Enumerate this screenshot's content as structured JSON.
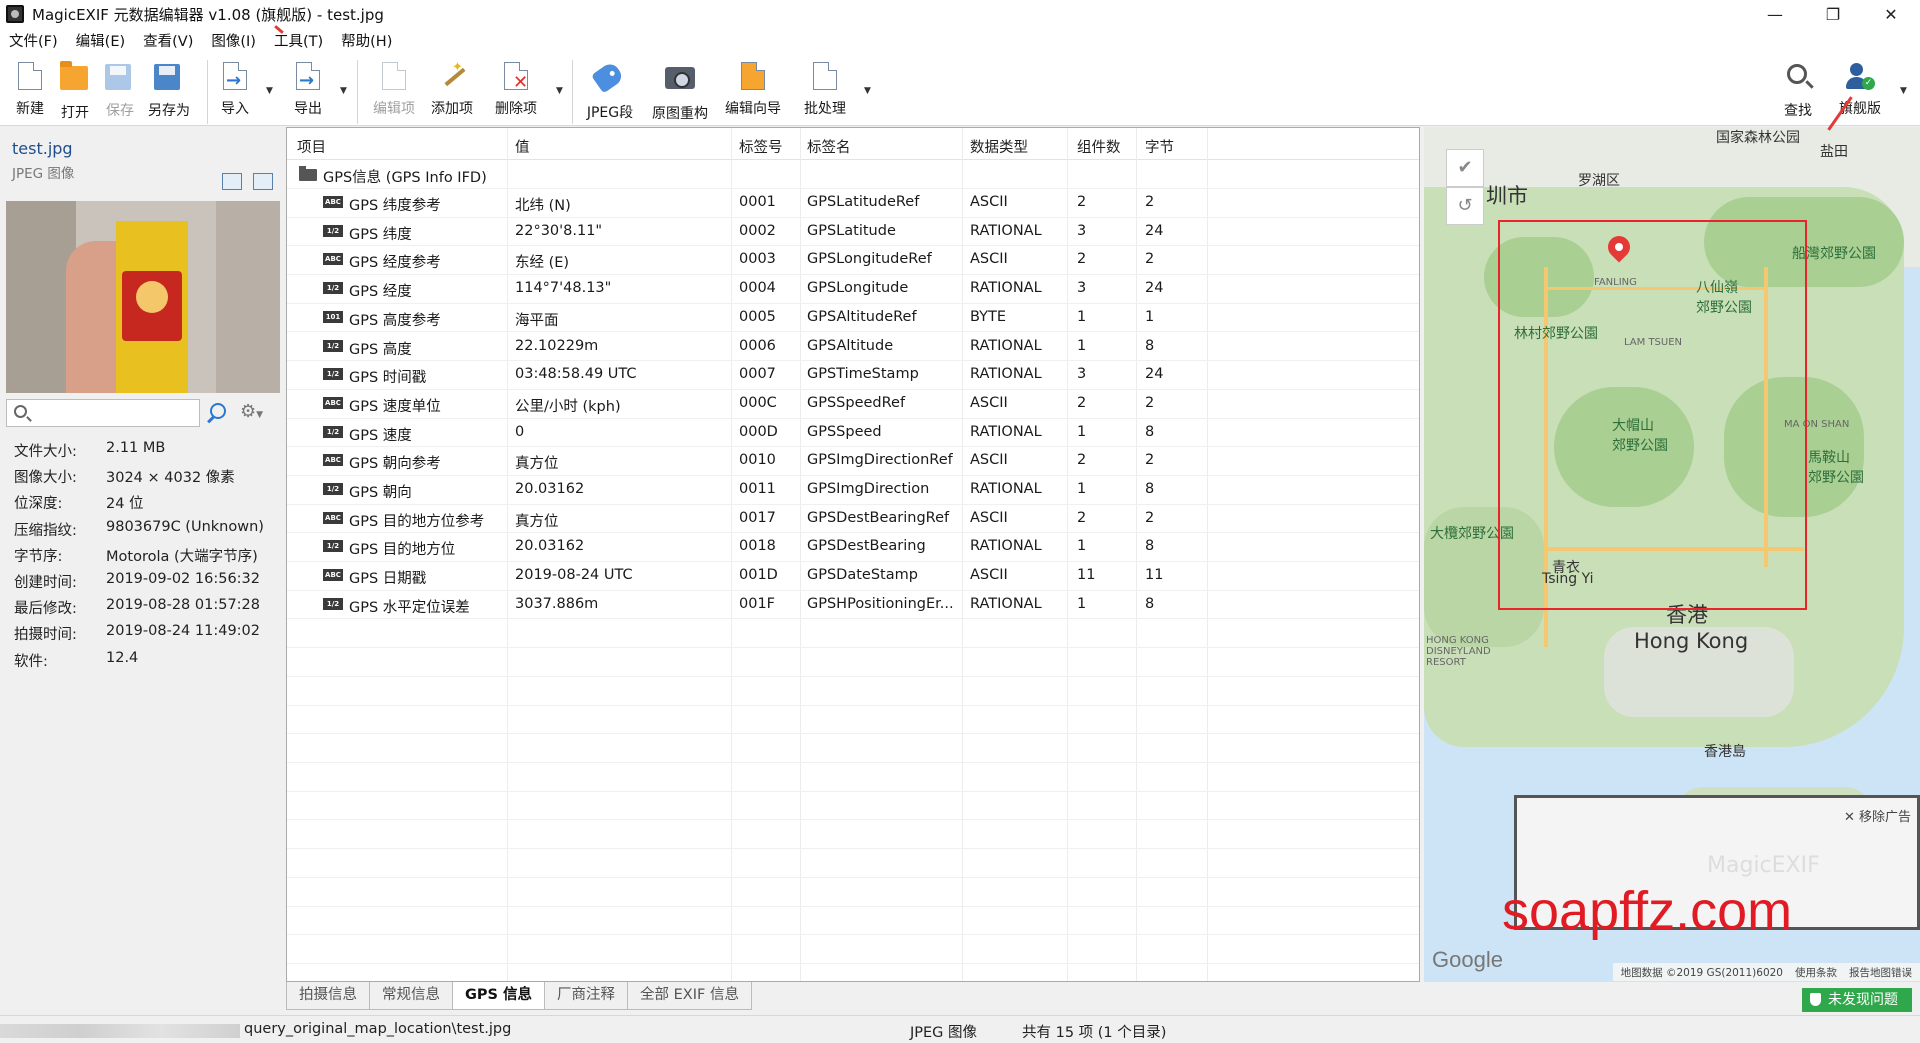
{
  "window": {
    "title": "MagicEXIF 元数据编辑器 v1.08 (旗舰版) - test.jpg",
    "minimize": "—",
    "maximize": "❐",
    "close": "✕"
  },
  "menu": [
    "文件(F)",
    "编辑(E)",
    "查看(V)",
    "图像(I)",
    "工具(T)",
    "帮助(H)"
  ],
  "toolbar": {
    "new": "新建",
    "open": "打开",
    "save": "保存",
    "save_as": "另存为",
    "import": "导入",
    "export": "导出",
    "edit_item": "编辑项",
    "add_item": "添加项",
    "delete_item": "删除项",
    "jpeg_segment": "JPEG段",
    "rebuild_image": "原图重构",
    "edit_wizard": "编辑向导",
    "batch": "批处理",
    "find": "查找",
    "flagship": "旗舰版"
  },
  "sidebar": {
    "file_name": "test.jpg",
    "file_type": "JPEG 图像",
    "search_placeholder": "",
    "info": [
      {
        "label": "文件大小:",
        "value": "2.11 MB"
      },
      {
        "label": "图像大小:",
        "value": "3024 × 4032 像素"
      },
      {
        "label": "位深度:",
        "value": "24 位"
      },
      {
        "label": "压缩指纹:",
        "value": "9803679C (Unknown)"
      },
      {
        "label": "字节序:",
        "value": "Motorola (大端字节序)"
      },
      {
        "label": "创建时间:",
        "value": "2019-09-02 16:56:32"
      },
      {
        "label": "最后修改:",
        "value": "2019-08-28 01:57:28"
      },
      {
        "label": "拍摄时间:",
        "value": "2019-08-24 11:49:02"
      },
      {
        "label": "软件:",
        "value": "12.4"
      }
    ]
  },
  "table": {
    "headers": [
      "项目",
      "值",
      "标签号",
      "标签名",
      "数据类型",
      "组件数",
      "字节"
    ],
    "group": "GPS信息 (GPS Info IFD)",
    "rows": [
      {
        "icon": "ABC",
        "item": "GPS 纬度参考",
        "value": "北纬 (N)",
        "tag": "0001",
        "name": "GPSLatitudeRef",
        "type": "ASCII",
        "count": "2",
        "bytes": "2"
      },
      {
        "icon": "1/2",
        "item": "GPS 纬度",
        "value": "22°30'8.11\"",
        "tag": "0002",
        "name": "GPSLatitude",
        "type": "RATIONAL",
        "count": "3",
        "bytes": "24"
      },
      {
        "icon": "ABC",
        "item": "GPS 经度参考",
        "value": "东经 (E)",
        "tag": "0003",
        "name": "GPSLongitudeRef",
        "type": "ASCII",
        "count": "2",
        "bytes": "2"
      },
      {
        "icon": "1/2",
        "item": "GPS 经度",
        "value": "114°7'48.13\"",
        "tag": "0004",
        "name": "GPSLongitude",
        "type": "RATIONAL",
        "count": "3",
        "bytes": "24"
      },
      {
        "icon": "101",
        "item": "GPS 高度参考",
        "value": "海平面",
        "tag": "0005",
        "name": "GPSAltitudeRef",
        "type": "BYTE",
        "count": "1",
        "bytes": "1"
      },
      {
        "icon": "1/2",
        "item": "GPS 高度",
        "value": "22.10229m",
        "tag": "0006",
        "name": "GPSAltitude",
        "type": "RATIONAL",
        "count": "1",
        "bytes": "8"
      },
      {
        "icon": "1/2",
        "item": "GPS 时间戳",
        "value": "03:48:58.49 UTC",
        "tag": "0007",
        "name": "GPSTimeStamp",
        "type": "RATIONAL",
        "count": "3",
        "bytes": "24"
      },
      {
        "icon": "ABC",
        "item": "GPS 速度单位",
        "value": "公里/小时 (kph)",
        "tag": "000C",
        "name": "GPSSpeedRef",
        "type": "ASCII",
        "count": "2",
        "bytes": "2"
      },
      {
        "icon": "1/2",
        "item": "GPS 速度",
        "value": "0",
        "tag": "000D",
        "name": "GPSSpeed",
        "type": "RATIONAL",
        "count": "1",
        "bytes": "8"
      },
      {
        "icon": "ABC",
        "item": "GPS 朝向参考",
        "value": "真方位",
        "tag": "0010",
        "name": "GPSImgDirectionRef",
        "type": "ASCII",
        "count": "2",
        "bytes": "2"
      },
      {
        "icon": "1/2",
        "item": "GPS 朝向",
        "value": "20.03162",
        "tag": "0011",
        "name": "GPSImgDirection",
        "type": "RATIONAL",
        "count": "1",
        "bytes": "8"
      },
      {
        "icon": "ABC",
        "item": "GPS 目的地方位参考",
        "value": "真方位",
        "tag": "0017",
        "name": "GPSDestBearingRef",
        "type": "ASCII",
        "count": "2",
        "bytes": "2"
      },
      {
        "icon": "1/2",
        "item": "GPS 目的地方位",
        "value": "20.03162",
        "tag": "0018",
        "name": "GPSDestBearing",
        "type": "RATIONAL",
        "count": "1",
        "bytes": "8"
      },
      {
        "icon": "ABC",
        "item": "GPS 日期戳",
        "value": "2019-08-24 UTC",
        "tag": "001D",
        "name": "GPSDateStamp",
        "type": "ASCII",
        "count": "11",
        "bytes": "11"
      },
      {
        "icon": "1/2",
        "item": "GPS 水平定位误差",
        "value": "3037.886m",
        "tag": "001F",
        "name": "GPSHPositioningEr...",
        "type": "RATIONAL",
        "count": "1",
        "bytes": "8"
      }
    ]
  },
  "tabs": [
    "拍摄信息",
    "常规信息",
    "GPS 信息",
    "厂商注释",
    "全部 EXIF 信息"
  ],
  "active_tab": "GPS 信息",
  "map": {
    "labels": {
      "shenzhen": "圳市",
      "luohu": "罗湖区",
      "national_park": "国家森林公园",
      "yantian": "盐田",
      "sai_kung": "船灣郊野公園",
      "pat_sin": "八仙嶺\n郊野公園",
      "fanling": "FANLING",
      "lam_tsuen_cn": "林村郊野公園",
      "lam_tsuen": "LAM TSUEN",
      "tai_mo_shan": "大帽山\n郊野公園",
      "ma_on_shan": "MA ON SHAN",
      "ma_on_shan_cn": "馬鞍山\n郊野公園",
      "tai_lam": "大欖郊野公園",
      "tsing_yi_cn": "青衣",
      "tsing_yi": "Tsing Yi",
      "hk_cn": "香港",
      "hk": "Hong Kong",
      "hk_island": "香港島",
      "disney": "HONG KONG\nDISNEYLAND\nRESORT"
    },
    "check": "✔",
    "undo": "↺",
    "ad_close": "✕ 移除广告",
    "ad_watermark": "MagicEXIF",
    "google": "Google",
    "footer": [
      "地图数据 ©2019 GS(2011)6020",
      "使用条款",
      "报告地图错误"
    ]
  },
  "watermark": "soapffz.com",
  "status": {
    "path": "query_original_map_location\\test.jpg",
    "type": "JPEG 图像",
    "count": "共有 15 项 (1 个目录)",
    "no_issue": "未发现问题"
  }
}
